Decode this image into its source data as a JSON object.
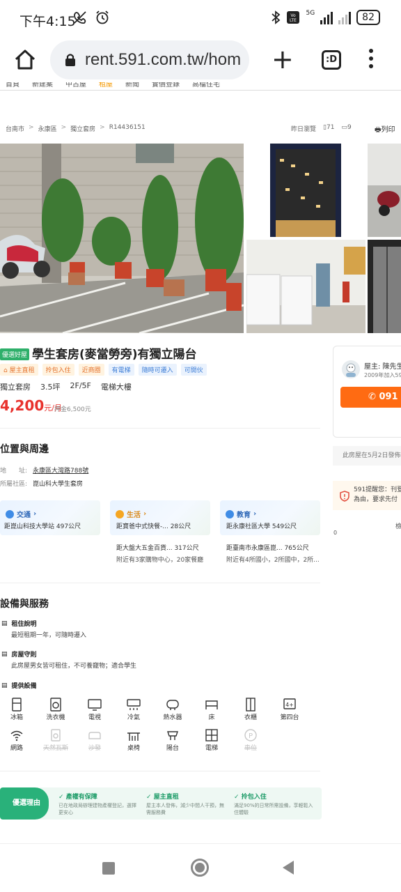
{
  "status_bar": {
    "time": "下午4:15",
    "battery": "82",
    "network": "5G"
  },
  "browser": {
    "url": "rent.591.com.tw/hom",
    "tabs_label": ":D"
  },
  "site_nav": [
    "首頁",
    "新建案",
    "中古屋",
    "租屋",
    "新聞",
    "實價登錄",
    "高檔住宅"
  ],
  "breadcrumb": [
    "台南市",
    "永康區",
    "獨立套房",
    "R14436151"
  ],
  "meta": {
    "views_label": "昨日瀏覽",
    "views": "71",
    "comments": "9",
    "print": "列印"
  },
  "listing": {
    "badge": "優選好屋",
    "title": "學生套房(麥當勞旁)有獨立陽台",
    "tags": [
      {
        "label": "屋主直租",
        "style": "orange"
      },
      {
        "label": "拎包入住",
        "style": "orange"
      },
      {
        "label": "近商圈",
        "style": "orange"
      },
      {
        "label": "有電梯",
        "style": "blue"
      },
      {
        "label": "隨時可遷入",
        "style": "blue"
      },
      {
        "label": "可開伙",
        "style": "blue"
      }
    ],
    "specs": [
      "獨立套房",
      "3.5坪",
      "2F/5F",
      "電梯大樓"
    ],
    "price": "4,200",
    "price_unit": "元/月",
    "deposit": "押金6,500元"
  },
  "owner": {
    "name": "屋主: 陳先生",
    "since": "2009年加入59",
    "phone": "091",
    "published": "此房屋在5月2日發佈",
    "alert": [
      "591提醒您：刊登",
      "為由，要求先付"
    ],
    "tail": "檢",
    "zero": "0"
  },
  "location": {
    "title": "位置與周邊",
    "address_label": "地　　址:",
    "address": "永康區大灣路788號",
    "community_label": "所屬社區:",
    "community": "崑山科大學生套房",
    "pois": [
      {
        "head": "交通",
        "line1": "距崑山科技大學站 497公尺",
        "line2": "",
        "line3": "",
        "color": "#3f8ce6"
      },
      {
        "head": "生活",
        "line1": "距寶爸中式快餐-...  28公尺",
        "line2": "距大盤大五金百貨... 317公尺",
        "line3": "附近有3家購物中心，20家餐廳",
        "color": "#f5a623"
      },
      {
        "head": "教育",
        "line1": "距永康社區大學 549公尺",
        "line2": "距臺南市永康區崑... 765公尺",
        "line3": "附近有4所國小，2所國中，2所...",
        "color": "#3f8ce6"
      }
    ]
  },
  "facilities": {
    "title": "設備與服務",
    "rent_head": "租住說明",
    "rent_text": "最短租期一年，可隨時遷入",
    "rules_head": "房屋守則",
    "rules_text": "此房屋男女皆可租住，不可養寵物；適合學生",
    "equip_head": "提供設備",
    "equipment": [
      {
        "label": "冰箱",
        "icon": "fridge-icon",
        "on": true
      },
      {
        "label": "洗衣機",
        "icon": "washer-icon",
        "on": true
      },
      {
        "label": "電視",
        "icon": "tv-icon",
        "on": true
      },
      {
        "label": "冷氣",
        "icon": "ac-icon",
        "on": true
      },
      {
        "label": "熱水器",
        "icon": "water-heater-icon",
        "on": true
      },
      {
        "label": "床",
        "icon": "bed-icon",
        "on": true
      },
      {
        "label": "衣櫃",
        "icon": "wardrobe-icon",
        "on": true
      },
      {
        "label": "第四台",
        "icon": "cable-tv-icon",
        "on": true
      },
      {
        "label": "網路",
        "icon": "wifi-icon",
        "on": true
      },
      {
        "label": "天然瓦斯",
        "icon": "gas-icon",
        "on": false
      },
      {
        "label": "沙發",
        "icon": "sofa-icon",
        "on": false
      },
      {
        "label": "桌椅",
        "icon": "desk-chair-icon",
        "on": true
      },
      {
        "label": "陽台",
        "icon": "balcony-icon",
        "on": true
      },
      {
        "label": "電梯",
        "icon": "elevator-icon",
        "on": true
      },
      {
        "label": "車位",
        "icon": "parking-icon",
        "on": false
      }
    ]
  },
  "reasons": {
    "badge": "優選理由",
    "items": [
      {
        "title": "產權有保障",
        "desc": "已在地政局辦理建物產權登記，選擇更安心"
      },
      {
        "title": "屋主直租",
        "desc": "屋主本人發佈，減少中間人干預，無需服務費"
      },
      {
        "title": "拎包入住",
        "desc": "滿足90%的日常所需設備，享輕鬆入住體驗"
      }
    ]
  }
}
